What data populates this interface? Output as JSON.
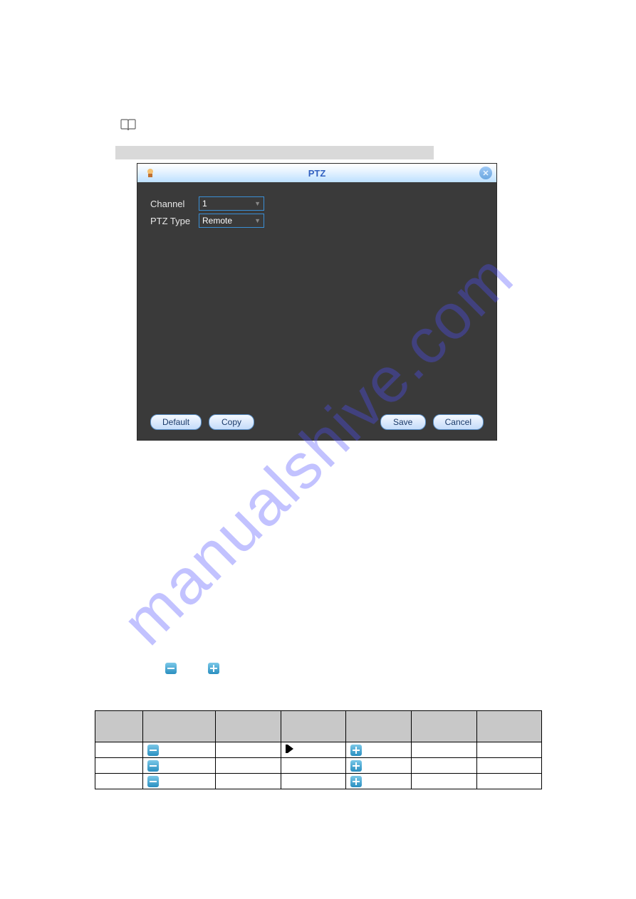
{
  "watermark": "manualshive.com",
  "dialog": {
    "title": "PTZ",
    "channel_label": "Channel",
    "channel_value": "1",
    "ptztype_label": "PTZ Type",
    "ptztype_value": "Remote",
    "buttons": {
      "default": "Default",
      "copy": "Copy",
      "save": "Save",
      "cancel": "Cancel"
    }
  },
  "table": {
    "headers": [
      "",
      "",
      "",
      "",
      "",
      "",
      ""
    ],
    "rows": [
      {
        "c1": "",
        "icon1": "minus",
        "c3": "",
        "icon2": "play",
        "icon3": "plus",
        "c6": "",
        "c7": ""
      },
      {
        "c1": "",
        "icon1": "minus",
        "c3": "",
        "icon2": "",
        "icon3": "plus",
        "c6": "",
        "c7": ""
      },
      {
        "c1": "",
        "icon1": "minus",
        "c3": "",
        "icon2": "",
        "icon3": "plus",
        "c6": "",
        "c7": ""
      }
    ]
  }
}
